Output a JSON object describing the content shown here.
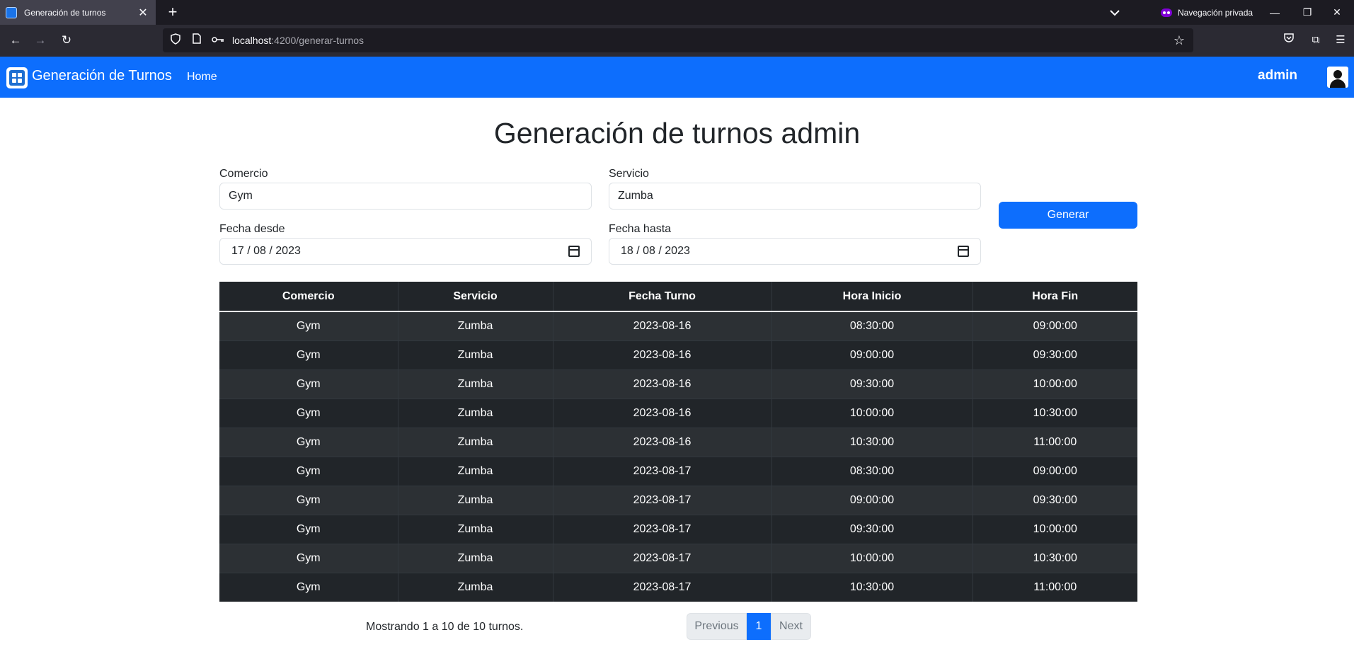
{
  "browser": {
    "tab_title": "Generación de turnos",
    "private_label": "Navegación privada",
    "url_host": "localhost",
    "url_path": ":4200/generar-turnos"
  },
  "nav": {
    "brand": "Generación de Turnos",
    "home": "Home",
    "user": "admin"
  },
  "page": {
    "title": "Generación de turnos admin"
  },
  "form": {
    "comercio_label": "Comercio",
    "comercio_value": "Gym",
    "servicio_label": "Servicio",
    "servicio_value": "Zumba",
    "fecha_desde_label": "Fecha desde",
    "fecha_desde_value": "17 / 08 / 2023",
    "fecha_hasta_label": "Fecha hasta",
    "fecha_hasta_value": "18 / 08 / 2023",
    "generar_label": "Generar"
  },
  "table": {
    "headers": [
      "Comercio",
      "Servicio",
      "Fecha Turno",
      "Hora Inicio",
      "Hora Fin"
    ],
    "rows": [
      [
        "Gym",
        "Zumba",
        "2023-08-16",
        "08:30:00",
        "09:00:00"
      ],
      [
        "Gym",
        "Zumba",
        "2023-08-16",
        "09:00:00",
        "09:30:00"
      ],
      [
        "Gym",
        "Zumba",
        "2023-08-16",
        "09:30:00",
        "10:00:00"
      ],
      [
        "Gym",
        "Zumba",
        "2023-08-16",
        "10:00:00",
        "10:30:00"
      ],
      [
        "Gym",
        "Zumba",
        "2023-08-16",
        "10:30:00",
        "11:00:00"
      ],
      [
        "Gym",
        "Zumba",
        "2023-08-17",
        "08:30:00",
        "09:00:00"
      ],
      [
        "Gym",
        "Zumba",
        "2023-08-17",
        "09:00:00",
        "09:30:00"
      ],
      [
        "Gym",
        "Zumba",
        "2023-08-17",
        "09:30:00",
        "10:00:00"
      ],
      [
        "Gym",
        "Zumba",
        "2023-08-17",
        "10:00:00",
        "10:30:00"
      ],
      [
        "Gym",
        "Zumba",
        "2023-08-17",
        "10:30:00",
        "11:00:00"
      ]
    ]
  },
  "pagination": {
    "summary": "Mostrando 1 a 10 de 10 turnos.",
    "previous": "Previous",
    "current": "1",
    "next": "Next"
  }
}
